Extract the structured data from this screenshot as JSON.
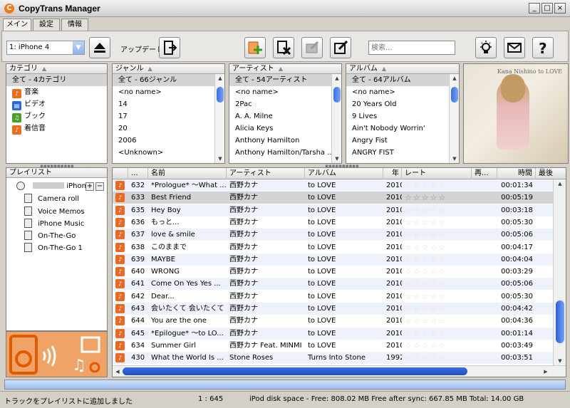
{
  "window": {
    "title": "CopyTrans Manager",
    "minimize": "_",
    "maximize": "□",
    "close": "×"
  },
  "tabs": [
    "メイン",
    "設定",
    "情報"
  ],
  "toolbar": {
    "device": "1: iPhone 4",
    "update_label": "アップデート",
    "search_placeholder": "検索..."
  },
  "category": {
    "header": "カテゴリ",
    "items": [
      "全て - 4カテゴリ",
      "音楽",
      "ビデオ",
      "ブック",
      "着信音"
    ]
  },
  "genre": {
    "header": "ジャンル",
    "items": [
      "全て - 66ジャンル",
      "<no name>",
      "14",
      "17",
      "20",
      "2006",
      "<Unknown>"
    ]
  },
  "artist": {
    "header": "アーティスト",
    "items": [
      "全て - 54アーティスト",
      "<no name>",
      "2Pac",
      "A. A. Milne",
      "Alicia Keys",
      "Anthony Hamilton",
      "Anthony Hamilton/Tarsha ..."
    ]
  },
  "album": {
    "header": "アルバム",
    "items": [
      "全て - 64アルバム",
      "<no name>",
      "20 Years Old",
      "9 Lives",
      "Ain't Nobody Worrin'",
      "Angry Fist",
      "ANGRY FIST"
    ]
  },
  "album_art": {
    "caption": "Kana Nishino to LOVE"
  },
  "playlist": {
    "header": "プレイリスト",
    "device": "iPhone",
    "items": [
      "Camera roll",
      "Voice Memos",
      "iPhone Music",
      "On-The-Go",
      "On-The-Go 1"
    ]
  },
  "tracks": {
    "columns": [
      "...",
      "名前",
      "アーティスト",
      "アルバム",
      "年",
      "レート",
      "再...",
      "時間",
      "最後"
    ],
    "rows": [
      {
        "no": "632",
        "name": "*Prologue* ～What ...",
        "artist": "西野カナ",
        "album": "to LOVE",
        "year": "2010",
        "time": "00:01:34"
      },
      {
        "no": "633",
        "name": "Best Friend",
        "artist": "西野カナ",
        "album": "to LOVE",
        "year": "2010",
        "time": "00:05:19"
      },
      {
        "no": "635",
        "name": "Hey Boy",
        "artist": "西野カナ",
        "album": "to LOVE",
        "year": "2010",
        "time": "00:03:18"
      },
      {
        "no": "636",
        "name": "もっと...",
        "artist": "西野カナ",
        "album": "to LOVE",
        "year": "2010",
        "time": "00:05:30"
      },
      {
        "no": "637",
        "name": "love & smile",
        "artist": "西野カナ",
        "album": "to LOVE",
        "year": "2010",
        "time": "00:05:06"
      },
      {
        "no": "638",
        "name": "このままで",
        "artist": "西野カナ",
        "album": "to LOVE",
        "year": "2010",
        "time": "00:04:17"
      },
      {
        "no": "639",
        "name": "MAYBE",
        "artist": "西野カナ",
        "album": "to LOVE",
        "year": "2010",
        "time": "00:04:04"
      },
      {
        "no": "640",
        "name": "WRONG",
        "artist": "西野カナ",
        "album": "to LOVE",
        "year": "2010",
        "time": "00:03:29"
      },
      {
        "no": "641",
        "name": "Come On Yes Yes ...",
        "artist": "西野カナ",
        "album": "to LOVE",
        "year": "2010",
        "time": "00:05:06"
      },
      {
        "no": "642",
        "name": "Dear...",
        "artist": "西野カナ",
        "album": "to LOVE",
        "year": "2010",
        "time": "00:05:30"
      },
      {
        "no": "643",
        "name": "会いたくて 会いたくて",
        "artist": "西野カナ",
        "album": "to LOVE",
        "year": "2010",
        "time": "00:04:42"
      },
      {
        "no": "644",
        "name": "You are the one",
        "artist": "西野カナ",
        "album": "to LOVE",
        "year": "2010",
        "time": "00:04:36"
      },
      {
        "no": "645",
        "name": "*Epilogue* ～to LO...",
        "artist": "西野カナ",
        "album": "to LOVE",
        "year": "2010",
        "time": "00:01:14"
      },
      {
        "no": "634",
        "name": "Summer Girl",
        "artist": "西野カナ Feat. MINMI",
        "album": "to LOVE",
        "year": "2010",
        "time": "00:03:49"
      },
      {
        "no": "430",
        "name": "What the World Is ...",
        "artist": "Stone Roses",
        "album": "Turns Into Stone",
        "year": "1992",
        "time": "00:03:51"
      }
    ]
  },
  "status": {
    "message": "トラックをプレイリストに追加しました",
    "count": "1 : 645",
    "disk": "iPod disk space - Free: 808.02 MB Free after sync: 667.85 MB Total: 14.00 GB"
  }
}
